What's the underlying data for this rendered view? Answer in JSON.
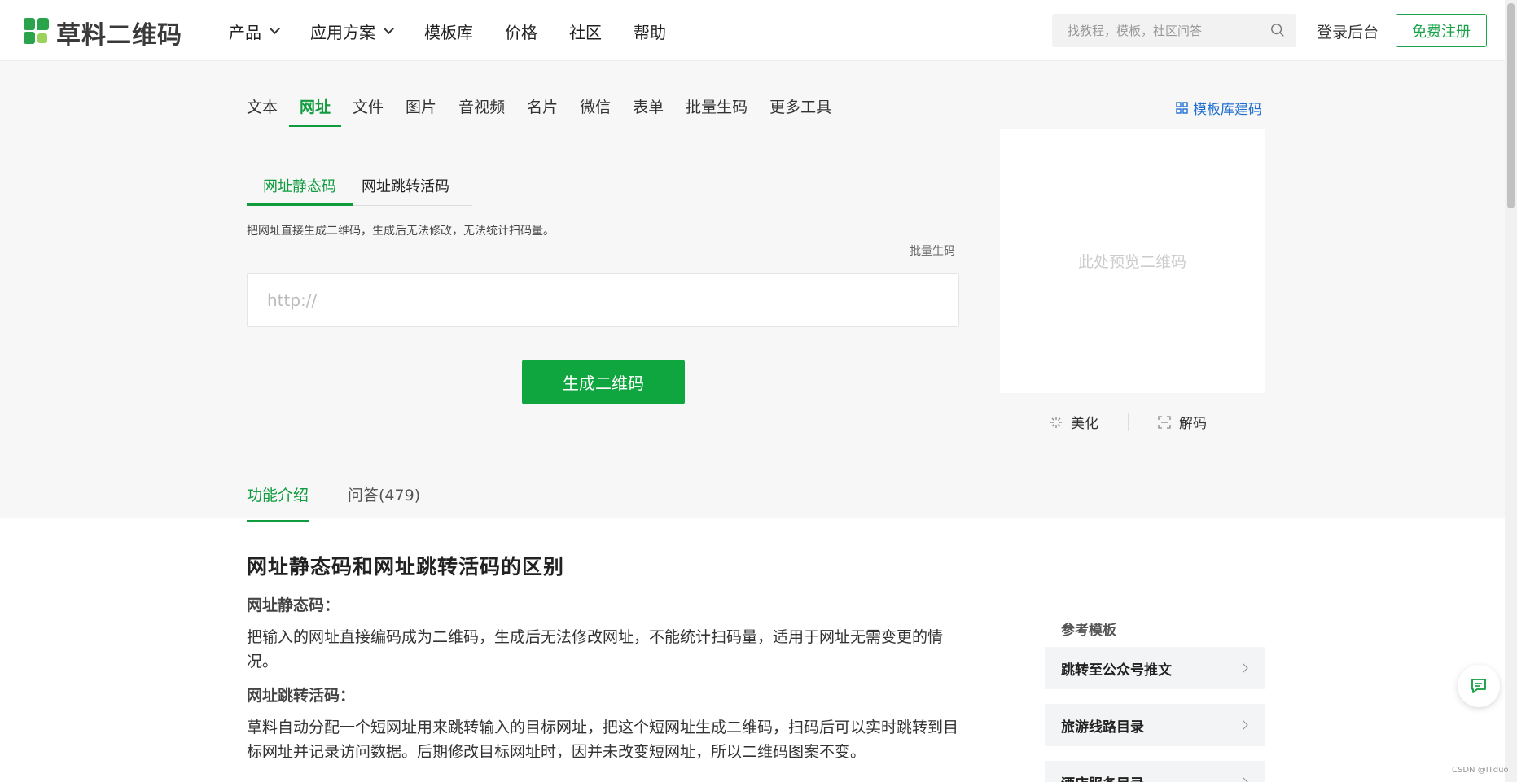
{
  "header": {
    "logo_text": "草料二维码",
    "nav": [
      {
        "label": "产品",
        "dropdown": true
      },
      {
        "label": "应用方案",
        "dropdown": true
      },
      {
        "label": "模板库",
        "dropdown": false
      },
      {
        "label": "价格",
        "dropdown": false
      },
      {
        "label": "社区",
        "dropdown": false
      },
      {
        "label": "帮助",
        "dropdown": false
      }
    ],
    "search_placeholder": "找教程，模板，社区问答",
    "login_label": "登录后台",
    "register_label": "免费注册"
  },
  "tabs": {
    "items": [
      "文本",
      "网址",
      "文件",
      "图片",
      "音视频",
      "名片",
      "微信",
      "表单",
      "批量生码",
      "更多工具"
    ],
    "active": "网址",
    "template_link": "模板库建码"
  },
  "subtabs": {
    "items": [
      "网址静态码",
      "网址跳转活码"
    ],
    "active": "网址静态码"
  },
  "form": {
    "description": "把网址直接生成二维码，生成后无法修改，无法统计扫码量。",
    "batch_label": "批量生码",
    "url_placeholder": "http://",
    "generate_label": "生成二维码"
  },
  "preview": {
    "placeholder": "此处预览二维码",
    "beautify_label": "美化",
    "decode_label": "解码"
  },
  "info_tabs": {
    "items": [
      "功能介绍",
      "问答(479)"
    ],
    "active": "功能介绍"
  },
  "article": {
    "title": "网址静态码和网址跳转活码的区别",
    "h1": "网址静态码：",
    "p1": "把输入的网址直接编码成为二维码，生成后无法修改网址，不能统计扫码量，适用于网址无需变更的情况。",
    "h2": "网址跳转活码：",
    "p2": "草料自动分配一个短网址用来跳转输入的目标网址，把这个短网址生成二维码，扫码后可以实时跳转到目标网址并记录访问数据。后期修改目标网址时，因并未改变短网址，所以二维码图案不变。"
  },
  "reference": {
    "title": "参考模板",
    "items": [
      "跳转至公众号推文",
      "旅游线路目录",
      "酒店服务目录"
    ]
  },
  "watermark": "CSDN @ITduo",
  "colors": {
    "brand_green": "#0f9b3e",
    "button_green": "#0fa53f",
    "link_blue": "#1f6fd1"
  }
}
